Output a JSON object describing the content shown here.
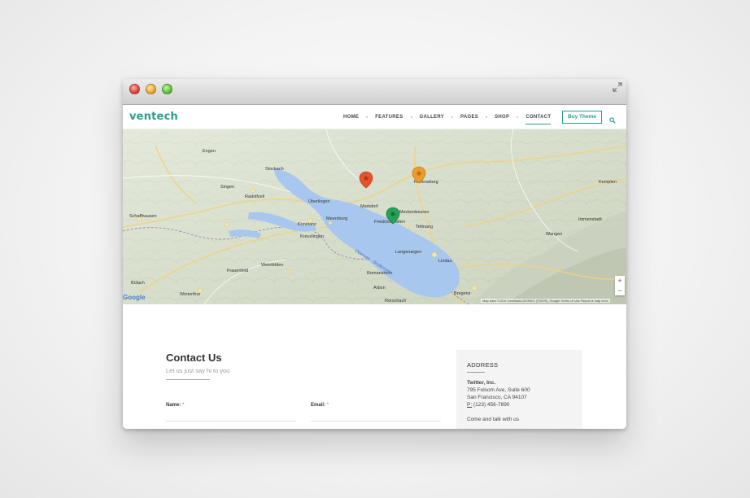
{
  "browser": {
    "expand_icon": "expand-arrows-icon"
  },
  "navbar": {
    "logo": "ventech",
    "items": [
      {
        "label": "HOME"
      },
      {
        "label": "FEATURES"
      },
      {
        "label": "GALLERY"
      },
      {
        "label": "PAGES"
      },
      {
        "label": "SHOP"
      },
      {
        "label": "CONTACT",
        "active": true
      }
    ],
    "buy_label": "Buy Theme",
    "accent": "#2a9d8f"
  },
  "map": {
    "places": [
      "Engen",
      "Singen",
      "Radolfzell",
      "Schaffhausen",
      "Konstanz",
      "Meersburg",
      "Überlingen",
      "Markdorf",
      "Friedrichshafen",
      "Meckenbeuren",
      "Ravensburg",
      "Tettnang",
      "Langenargen",
      "Lindau",
      "Bregenz",
      "Romanshorn",
      "Arbon",
      "Rorschach",
      "Kreuzlingen",
      "Weinfelden",
      "Frauenfeld",
      "Winterthur",
      "Bülach",
      "Stockach",
      "Wangen",
      "Kempten",
      "Immenstadt"
    ],
    "lake_label": "Obersee · Bodensee",
    "google_label": "Google",
    "attribution": "Map data ©2016 GeoBasis-DE/BKG (©2009), Google  Terms of Use  Report a map error",
    "zoom_in": "+",
    "zoom_out": "−",
    "pin_colors": [
      "#e5532d",
      "#ec9a2e",
      "#27a057"
    ]
  },
  "contact": {
    "title": "Contact Us",
    "subtitle": "Let us just say hi to you",
    "fields": [
      {
        "label": "Name:",
        "required": "*"
      },
      {
        "label": "Email:",
        "required": "*"
      }
    ]
  },
  "address": {
    "title": "ADDRESS",
    "company": "Twitter, Inc.",
    "street": "795 Folsom Ave, Suite 600",
    "city": "San Francisco, CA 94107",
    "phone_prefix": "P:",
    "phone": "(123) 456-7890",
    "tagline": "Come and talk with us"
  }
}
